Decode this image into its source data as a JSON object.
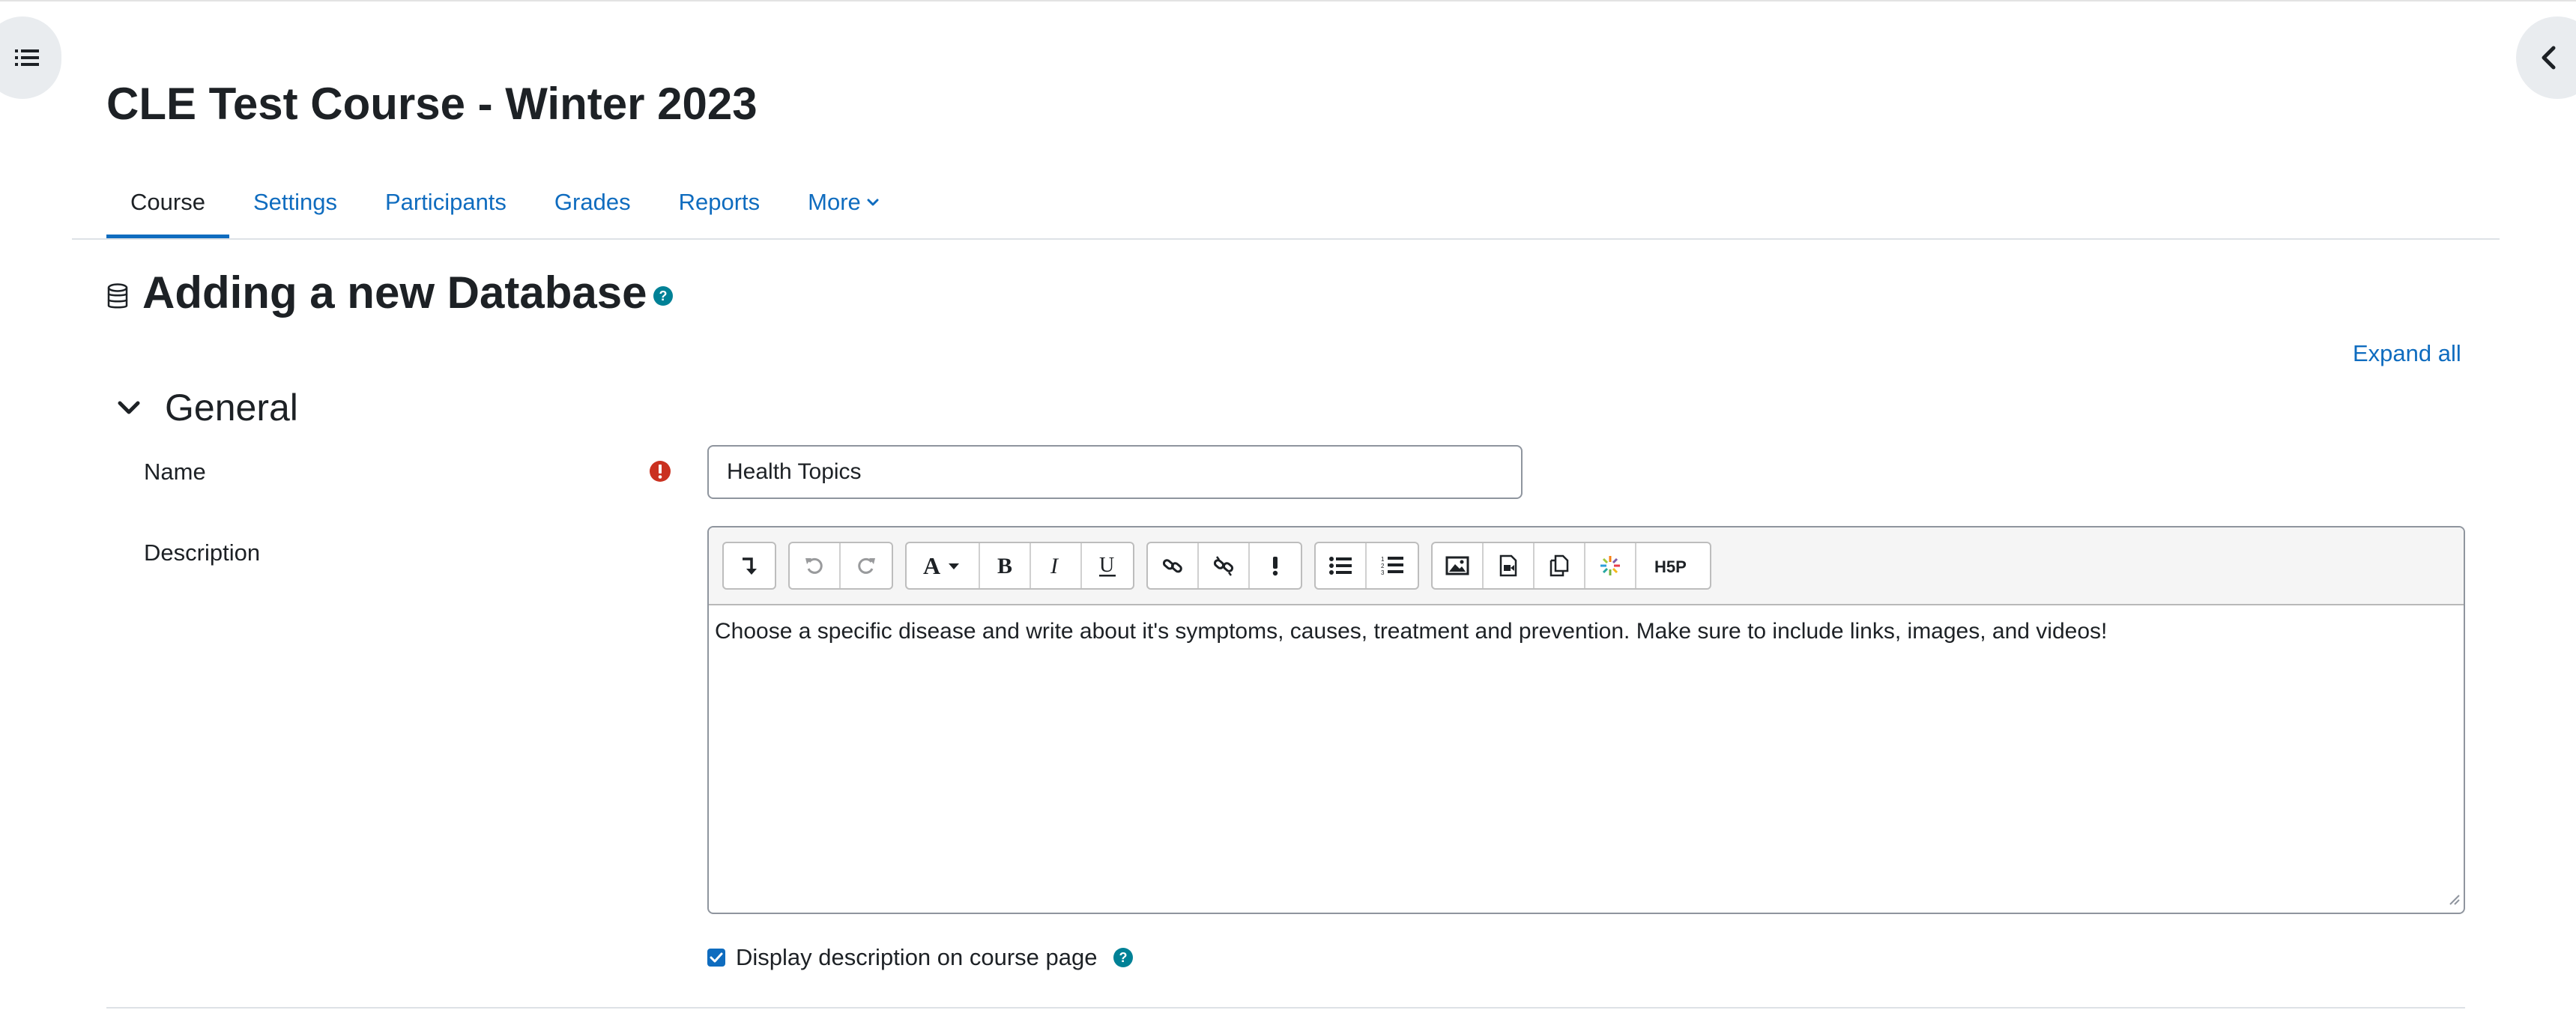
{
  "course": {
    "title": "CLE Test Course - Winter 2023"
  },
  "nav": {
    "items": [
      {
        "label": "Course",
        "active": true
      },
      {
        "label": "Settings",
        "active": false
      },
      {
        "label": "Participants",
        "active": false
      },
      {
        "label": "Grades",
        "active": false
      },
      {
        "label": "Reports",
        "active": false
      },
      {
        "label": "More",
        "active": false
      }
    ]
  },
  "page": {
    "heading": "Adding a new Database",
    "heading_icon": "database-icon"
  },
  "actions": {
    "expand_all": "Expand all"
  },
  "section": {
    "title": "General"
  },
  "form": {
    "name": {
      "label": "Name",
      "value": "Health Topics"
    },
    "description": {
      "label": "Description",
      "content": "Choose a specific disease and write about it's symptoms, causes, treatment and prevention. Make sure to include links, images, and videos!"
    },
    "display_description": {
      "label": "Display description on course page",
      "checked": true
    }
  },
  "toolbar": {
    "groups": [
      [
        "toggle-toolbar-icon"
      ],
      [
        "undo-icon",
        "redo-icon"
      ],
      [
        "font-style-icon",
        "bold-icon",
        "italic-icon",
        "underline-icon"
      ],
      [
        "link-icon",
        "unlink-icon",
        "accessibility-check-icon"
      ],
      [
        "bullet-list-icon",
        "numbered-list-icon"
      ],
      [
        "image-icon",
        "media-icon",
        "manage-files-icon",
        "recordrtc-icon",
        "h5p-icon"
      ]
    ]
  },
  "colors": {
    "accent": "#0f6cbf",
    "required": "#ca3120",
    "help": "#008196"
  }
}
